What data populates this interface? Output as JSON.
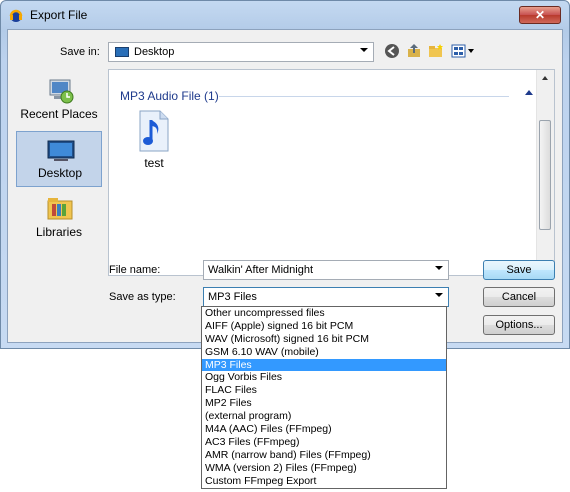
{
  "window": {
    "title": "Export File",
    "close": "✕"
  },
  "save_in": {
    "label": "Save in:",
    "value": "Desktop"
  },
  "toolbar_icons": [
    "back-icon",
    "up-folder-icon",
    "new-folder-icon",
    "view-menu-icon"
  ],
  "places": [
    {
      "label": "Recent Places",
      "icon": "recent-places-icon"
    },
    {
      "label": "Desktop",
      "icon": "desktop-icon",
      "selected": true
    },
    {
      "label": "Libraries",
      "icon": "libraries-icon"
    }
  ],
  "filelist": {
    "group_header": "MP3 Audio File (1)",
    "files": [
      {
        "name": "test",
        "icon": "audio-file-icon"
      }
    ]
  },
  "file_name": {
    "label": "File name:",
    "value": "Walkin' After Midnight"
  },
  "save_as_type": {
    "label": "Save as type:",
    "value": "MP3 Files",
    "options": [
      "Other uncompressed files",
      "AIFF (Apple) signed 16 bit PCM",
      "WAV (Microsoft) signed 16 bit PCM",
      "GSM 6.10 WAV (mobile)",
      "MP3 Files",
      "Ogg Vorbis Files",
      "FLAC Files",
      "MP2 Files",
      "(external program)",
      "M4A (AAC) Files (FFmpeg)",
      "AC3 Files (FFmpeg)",
      "AMR (narrow band) Files (FFmpeg)",
      "WMA (version 2) Files (FFmpeg)",
      "Custom FFmpeg Export"
    ],
    "selected_option": "MP3 Files"
  },
  "buttons": {
    "save": "Save",
    "cancel": "Cancel",
    "options": "Options..."
  },
  "colors": {
    "selection": "#3399ff",
    "group_header": "#1e3a8c",
    "title_bar": "#c4d9f1"
  }
}
